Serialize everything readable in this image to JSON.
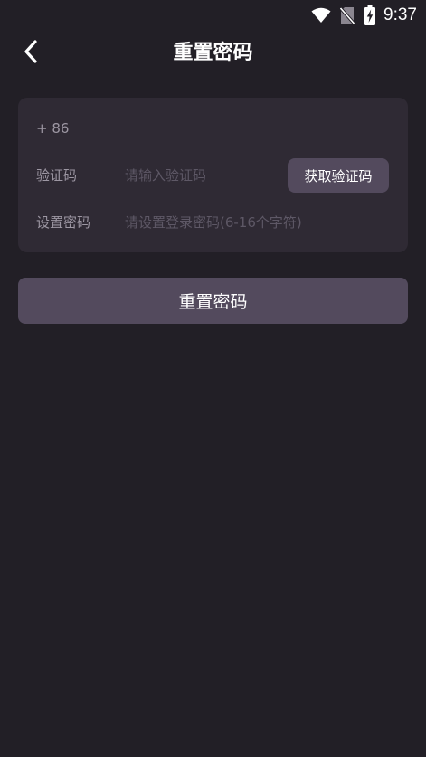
{
  "status_bar": {
    "time": "9:37",
    "icons": [
      "wifi-icon",
      "no-sim-icon",
      "battery-charging-icon"
    ]
  },
  "header": {
    "back_icon": "chevron-left-icon",
    "title": "重置密码"
  },
  "form": {
    "phone": {
      "prefix": "+ 86",
      "value": "",
      "placeholder": ""
    },
    "code": {
      "label": "验证码",
      "placeholder": "请输入验证码",
      "value": "",
      "get_code_label": "获取验证码"
    },
    "password": {
      "label": "设置密码",
      "placeholder": "请设置登录密码(6-16个字符)",
      "value": ""
    }
  },
  "submit": {
    "label": "重置密码"
  },
  "colors": {
    "background": "#221f26",
    "card": "#2f2a34",
    "button": "#534a5d",
    "label": "#9d97a3",
    "placeholder": "#5e5866"
  }
}
